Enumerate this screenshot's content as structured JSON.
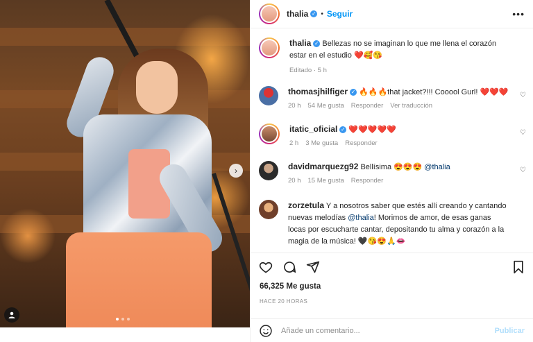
{
  "post": {
    "username": "thalia",
    "follow_label": "Seguir",
    "more_label": "•••",
    "separator": "•",
    "carousel": {
      "slides": 3,
      "active": 0
    }
  },
  "caption": {
    "username": "thalia",
    "text": "Bellezas no se imaginan lo que me llena el corazón estar en el estudio",
    "emojis": "❤️🥰😘",
    "meta": "Editado · 5 h"
  },
  "comments": [
    {
      "username": "thomasjhilfiger",
      "verified": true,
      "prefix_emojis": "🔥🔥🔥",
      "text": "that jacket?!!! Cooool Gurl!",
      "suffix_emojis": "❤️❤️❤️",
      "time": "20 h",
      "likes": "54 Me gusta",
      "reply": "Responder",
      "translate": "Ver traducción"
    },
    {
      "username": "itatic_oficial",
      "verified": true,
      "text": "",
      "suffix_emojis": "❤️❤️❤️❤️❤️",
      "time": "2 h",
      "likes": "3 Me gusta",
      "reply": "Responder"
    },
    {
      "username": "davidmarquezg92",
      "verified": false,
      "text": "Bellísima",
      "suffix_emojis": "😍😍😍",
      "mention": "@thalia",
      "time": "20 h",
      "likes": "15 Me gusta",
      "reply": "Responder"
    },
    {
      "username": "zorzetula",
      "verified": false,
      "text_before": "Y a nosotros saber que estés allí creando y cantando nuevas melodías",
      "mention": "@thalia",
      "text_after": "! Morimos de amor, de esas ganas locas por escucharte cantar, depositando tu alma y corazón a la magia de la música!",
      "suffix_emojis": "🖤😘😍🙏👄"
    }
  ],
  "stats": {
    "likes": "66,325 Me gusta",
    "time_ago": "HACE 20 HORAS"
  },
  "comment_box": {
    "placeholder": "Añade un comentario...",
    "publish": "Publicar"
  },
  "icons": [
    "heart-icon",
    "comment-icon",
    "share-icon",
    "save-icon",
    "emoji-icon",
    "tag-user-icon",
    "chevron-right-icon"
  ]
}
